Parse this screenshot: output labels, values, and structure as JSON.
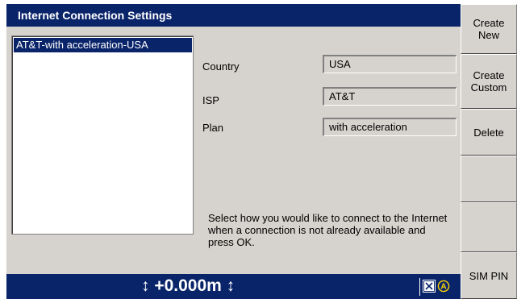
{
  "window": {
    "title": "Internet Connection Settings"
  },
  "connections": {
    "selected_item": "AT&T-with acceleration-USA"
  },
  "fields": {
    "country_label": "Country",
    "country_value": "USA",
    "isp_label": "ISP",
    "isp_value": "AT&T",
    "plan_label": "Plan",
    "plan_value": "with acceleration"
  },
  "info": {
    "text": "Select how you would like to connect to the Internet when a connection is not already available and press OK."
  },
  "buttons": {
    "create_new": "Create\nNew",
    "create_custom": "Create\nCustom",
    "delete": "Delete",
    "blank_1": "",
    "blank_2": "",
    "sim_pin": "SIM PIN"
  },
  "status": {
    "value": "↕ +0.000m ↕"
  },
  "colors": {
    "title_bar": "#0a246a",
    "panel": "#d6d3ce",
    "status_icon_accent": "#ffd400"
  },
  "icons": {
    "status_box": "checkbox-x-icon",
    "status_a": "circle-a-icon"
  }
}
